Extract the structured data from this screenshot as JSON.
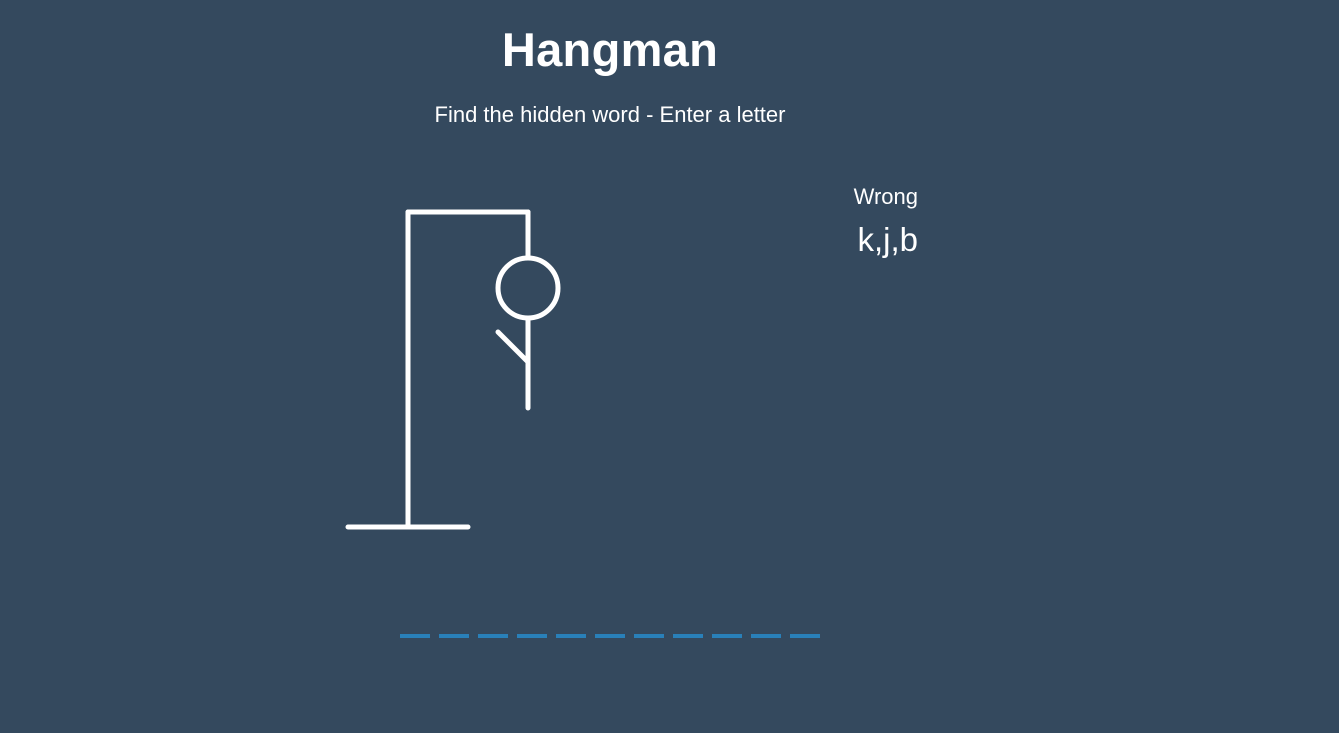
{
  "game": {
    "title": "Hangman",
    "instructions": "Find the hidden word - Enter a letter",
    "wrong_label": "Wrong",
    "wrong_letters_display": "k,j,b",
    "wrong_letters": [
      "k",
      "j",
      "b"
    ],
    "word_length": 11,
    "revealed_letters": [
      "",
      "",
      "",
      "",
      "",
      "",
      "",
      "",
      "",
      "",
      ""
    ],
    "visible_body_parts": [
      "head",
      "body",
      "left-arm"
    ]
  },
  "colors": {
    "background": "#34495e",
    "foreground": "#ffffff",
    "slot_accent": "#2980b9"
  }
}
